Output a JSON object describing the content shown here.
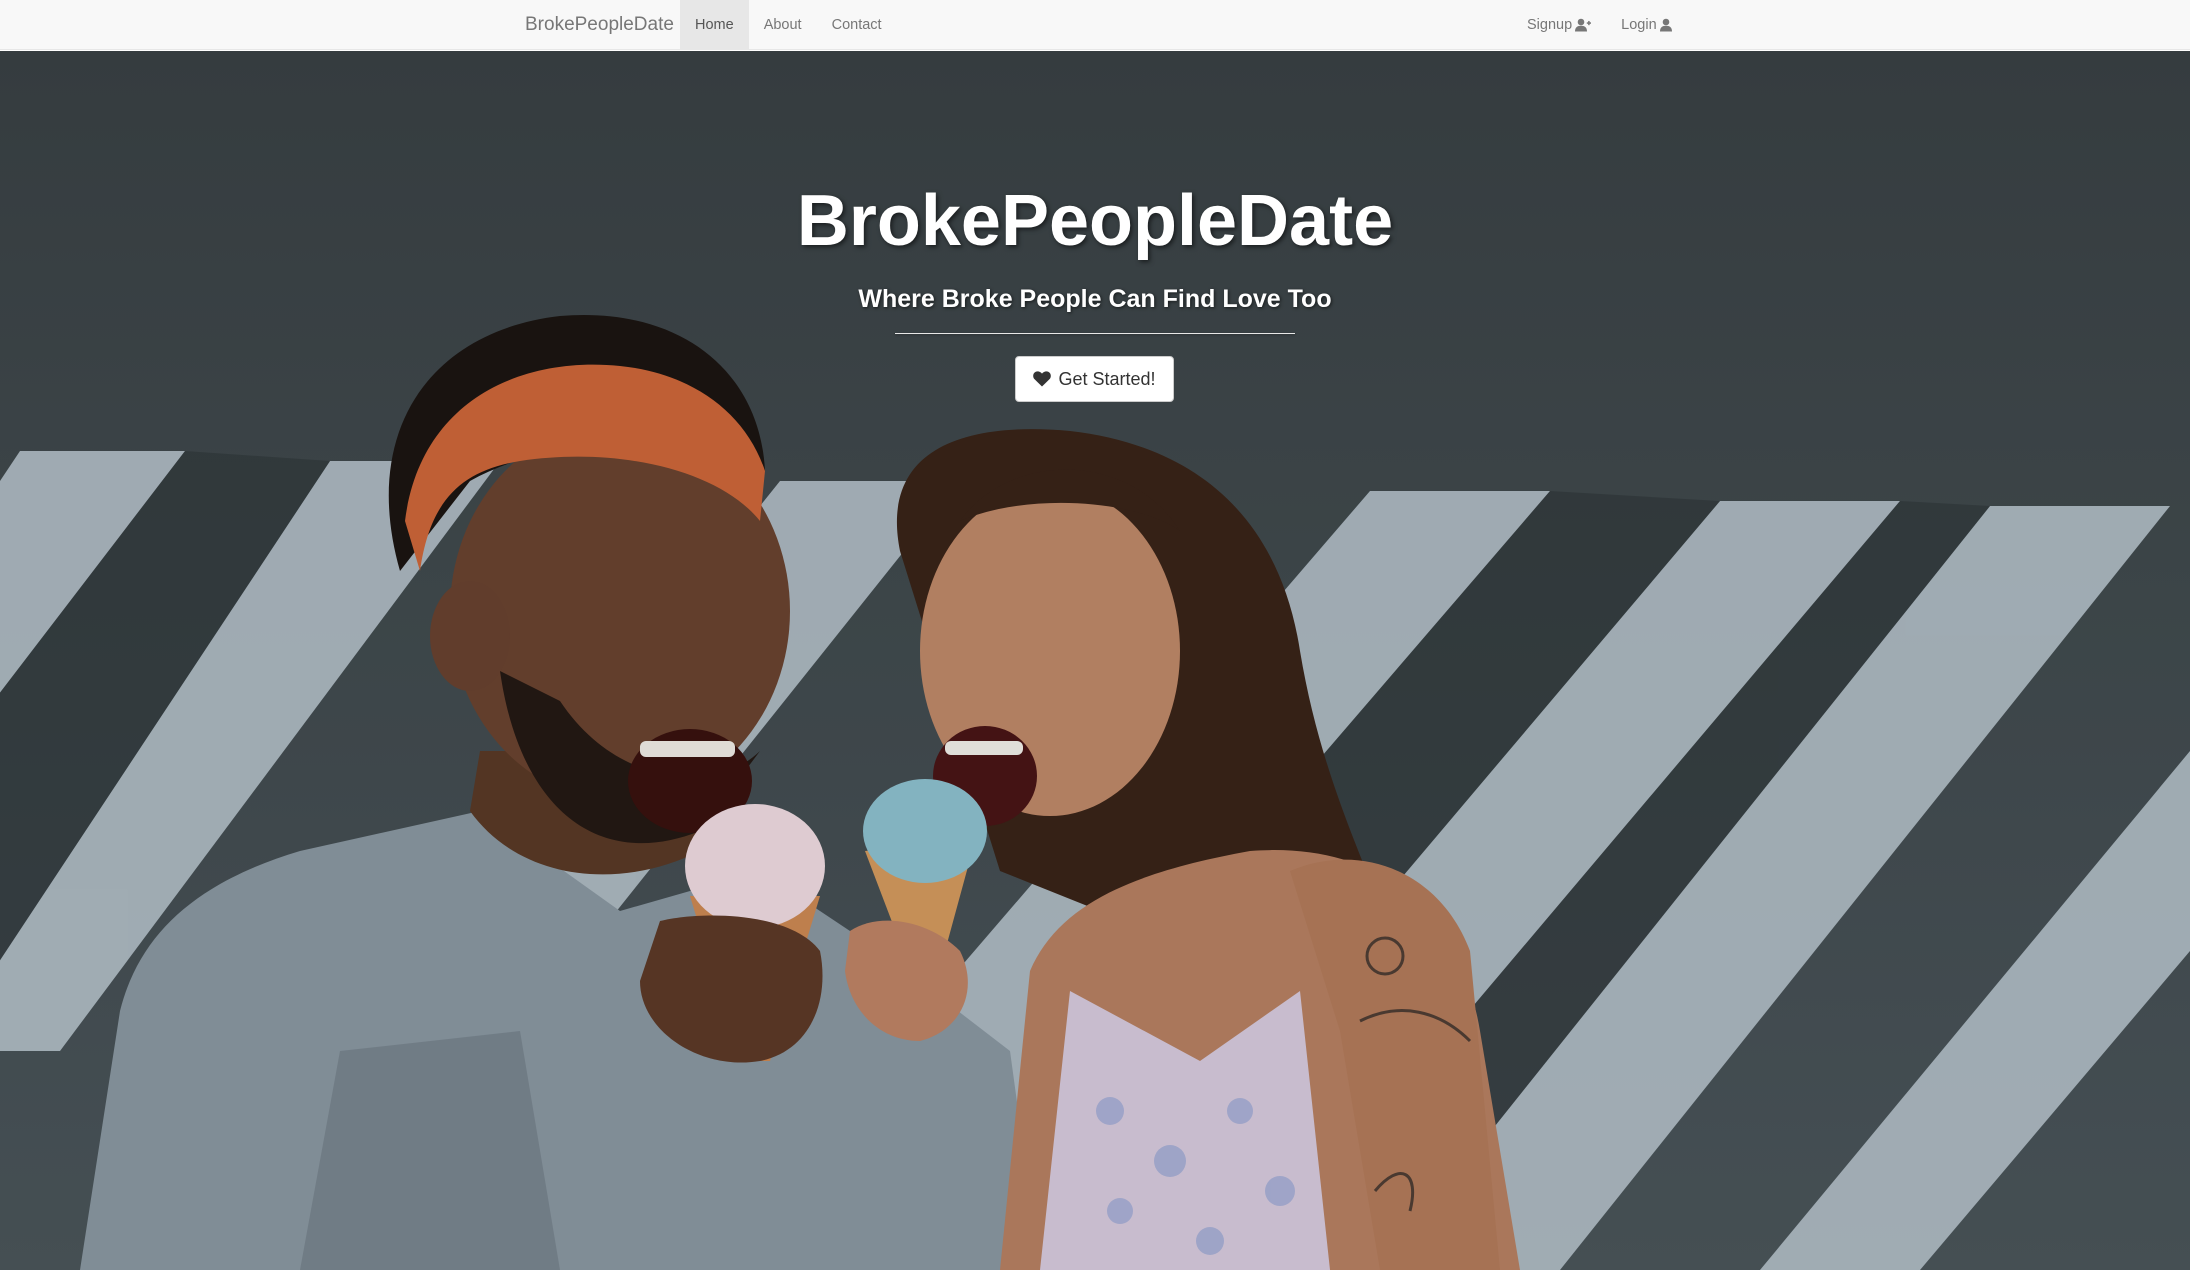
{
  "navbar": {
    "brand": "BrokePeopleDate",
    "left_items": [
      {
        "label": "Home",
        "active": true
      },
      {
        "label": "About",
        "active": false
      },
      {
        "label": "Contact",
        "active": false
      }
    ],
    "right_items": [
      {
        "label": "Signup",
        "icon": "user-plus-icon"
      },
      {
        "label": "Login",
        "icon": "user-icon"
      }
    ]
  },
  "hero": {
    "title": "BrokePeopleDate",
    "subtitle": "Where Broke People Can Find Love Too",
    "button": {
      "label": "Get Started!",
      "icon": "heart-icon"
    },
    "background_image": "couple-eating-ice-cream-photo"
  },
  "colors": {
    "navbar_bg": "#f8f8f8",
    "nav_text": "#777777",
    "active_bg": "#e7e7e7",
    "hero_text": "#ffffff",
    "button_text": "#333333"
  }
}
